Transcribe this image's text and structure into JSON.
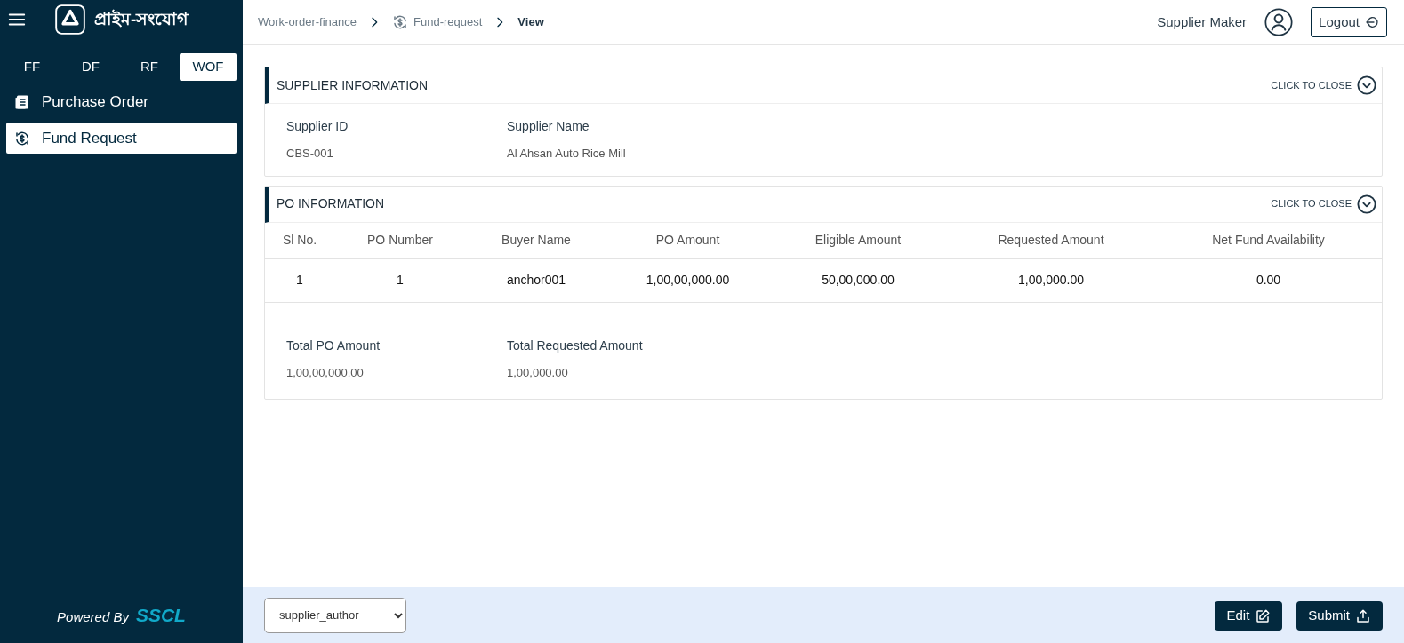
{
  "sidebar": {
    "logo_text": "প্রাইম-সংযোগ",
    "tabs": [
      {
        "label": "FF",
        "selected": false
      },
      {
        "label": "DF",
        "selected": false
      },
      {
        "label": "RF",
        "selected": false
      },
      {
        "label": "WOF",
        "selected": true
      }
    ],
    "items": [
      {
        "label": "Purchase Order",
        "kind": "list",
        "selected": false
      },
      {
        "label": "Fund Request",
        "kind": "fund",
        "selected": true
      }
    ],
    "powered_by": "Powered By",
    "brand": "SSCL"
  },
  "breadcrumb": [
    {
      "label": "Work-order-finance",
      "kind": "plain",
      "current": false
    },
    {
      "label": "Fund-request",
      "kind": "fund",
      "current": false
    },
    {
      "label": "View",
      "kind": "plain",
      "current": true
    }
  ],
  "header": {
    "user": "Supplier Maker",
    "logout": "Logout"
  },
  "supplier_section": {
    "title": "SUPPLIER INFORMATION",
    "toggle": "CLICK TO CLOSE",
    "fields": [
      {
        "label": "Supplier ID",
        "value": "CBS-001"
      },
      {
        "label": "Supplier Name",
        "value": "Al Ahsan Auto Rice Mill"
      }
    ]
  },
  "po_section": {
    "title": "PO INFORMATION",
    "toggle": "CLICK TO CLOSE",
    "columns": [
      "Sl No.",
      "PO Number",
      "Buyer Name",
      "PO Amount",
      "Eligible Amount",
      "Requested Amount",
      "Net Fund Availability"
    ],
    "rows": [
      [
        "1",
        "1",
        "anchor001",
        "1,00,00,000.00",
        "50,00,000.00",
        "1,00,000.00",
        "0.00"
      ]
    ],
    "totals": [
      {
        "label": "Total PO Amount",
        "value": "1,00,00,000.00"
      },
      {
        "label": "Total Requested Amount",
        "value": "1,00,000.00"
      }
    ]
  },
  "footer": {
    "select_value": "supplier_author",
    "buttons": [
      {
        "label": "Edit",
        "kind": "edit"
      },
      {
        "label": "Submit",
        "kind": "submit"
      }
    ]
  }
}
